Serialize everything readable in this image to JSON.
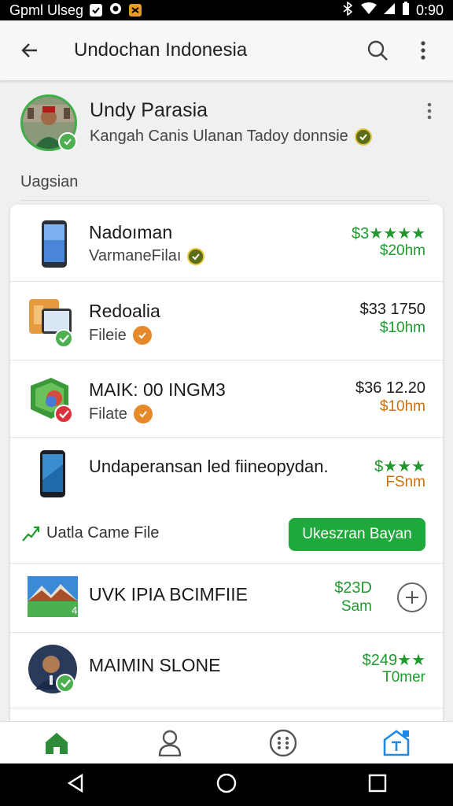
{
  "status_bar": {
    "left_text": "Gpml Ulseg",
    "time": "0:90"
  },
  "app_bar": {
    "title": "Undochan Indonesia"
  },
  "profile": {
    "name": "Undy Parasia",
    "subtitle": "Kangah Canis Ulanan Tadoy donnsie"
  },
  "section": {
    "label": "Uagsian"
  },
  "items": [
    {
      "title": "Nadoıman",
      "subtitle": "VarmaneFilaı",
      "price": "$3★★★★",
      "meta": "$20hm"
    },
    {
      "title": "Redoalia",
      "subtitle": "Fileie",
      "price": "$33  1750",
      "meta": "$10hm"
    },
    {
      "title": "MAIK: 00 INGM3",
      "subtitle": "Filate",
      "price": "$36  12.20",
      "meta": "$10hm"
    },
    {
      "title": "Undaperansan led fiineopydan.",
      "subtitle": "",
      "price": "$★★★",
      "meta": "FSnm"
    },
    {
      "title": "UVK IPIA BCIMFIIE",
      "subtitle": "",
      "price": "$23D",
      "meta": "Sam"
    },
    {
      "title": "MAIMIN SLONE",
      "subtitle": "",
      "price": "$249★★",
      "meta": "T0mer"
    }
  ],
  "action": {
    "label": "Uatla Came File",
    "button": "Ukeszran Bayan"
  },
  "icons": {
    "back": "arrow-left-icon",
    "search": "search-icon",
    "more": "more-vert-icon",
    "home": "home-icon",
    "profile": "person-icon",
    "apps": "apps-grid-icon",
    "store": "store-icon"
  },
  "colors": {
    "accent_green": "#1fa83b",
    "price_green": "#1e9a2e",
    "orange": "#c9700b",
    "store_blue": "#1e88e5"
  }
}
